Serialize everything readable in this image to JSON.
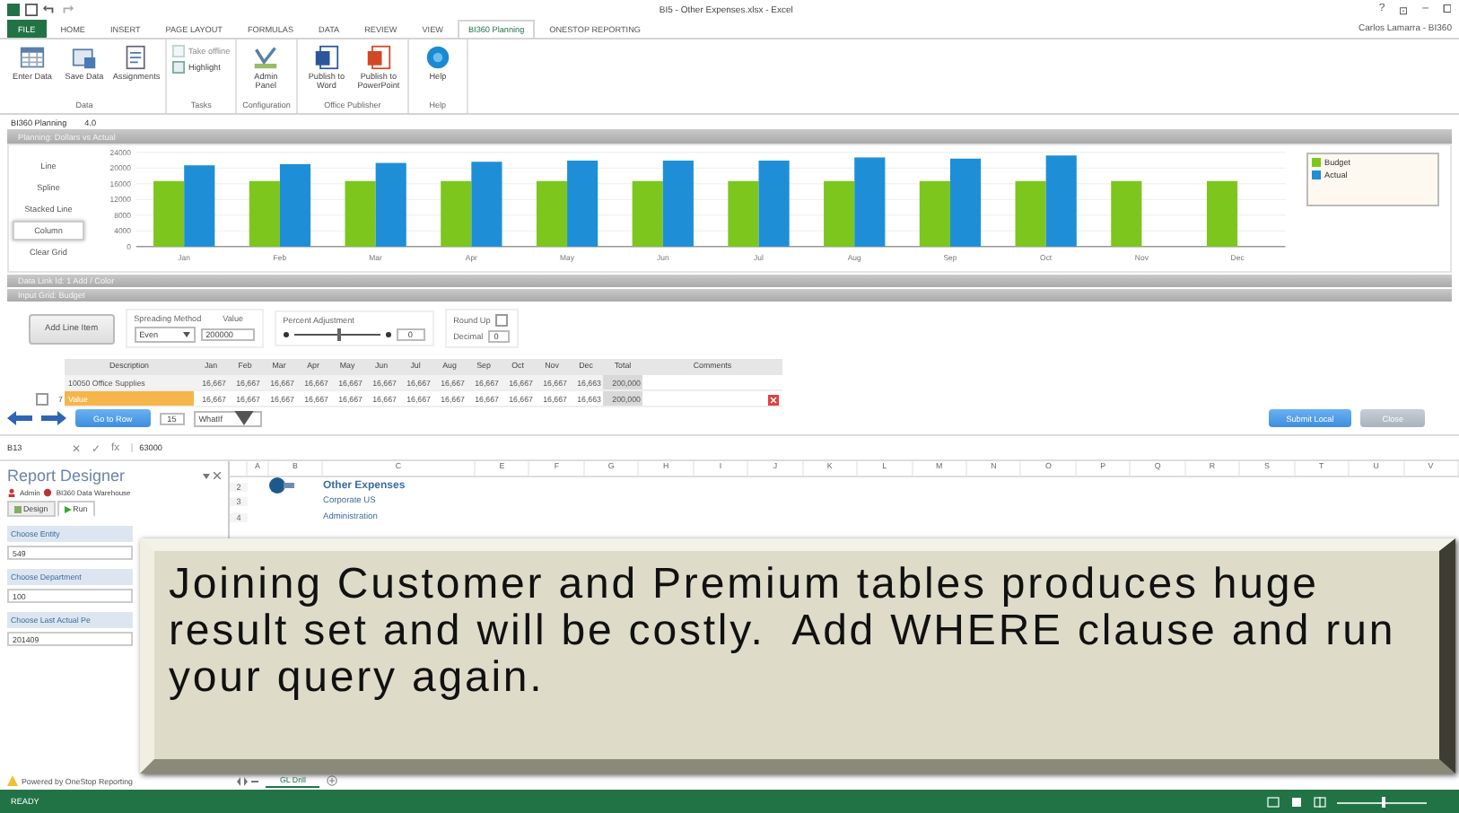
{
  "window": {
    "title": "BI5 - Other Expenses.xlsx - Excel",
    "controls": [
      "?",
      "⊡",
      "–",
      "⧠"
    ],
    "user": "Carlos Lamarra - BI360"
  },
  "ribbon_tabs": [
    {
      "label": "FILE",
      "kind": "file",
      "selected": false
    },
    {
      "label": "HOME",
      "kind": "tab",
      "selected": false
    },
    {
      "label": "INSERT",
      "kind": "tab",
      "selected": false
    },
    {
      "label": "PAGE LAYOUT",
      "kind": "tab",
      "selected": false
    },
    {
      "label": "FORMULAS",
      "kind": "tab",
      "selected": false
    },
    {
      "label": "DATA",
      "kind": "tab",
      "selected": false
    },
    {
      "label": "REVIEW",
      "kind": "tab",
      "selected": false
    },
    {
      "label": "VIEW",
      "kind": "tab",
      "selected": false
    },
    {
      "label": "BI360 Planning",
      "kind": "tab",
      "selected": true
    },
    {
      "label": "ONESTOP REPORTING",
      "kind": "tab",
      "selected": false
    }
  ],
  "ribbon_groups": [
    {
      "label": "Data",
      "buttons": [
        {
          "label": "Enter Data",
          "kind": "grid",
          "disabled": false
        },
        {
          "label": "Save Data",
          "kind": "save",
          "disabled": false
        },
        {
          "label": "Assignments",
          "kind": "list",
          "disabled": false
        }
      ]
    },
    {
      "label": "Tasks",
      "buttons": [
        {
          "label": "Take offline",
          "kind": "small",
          "disabled": true
        },
        {
          "label": "Highlight",
          "kind": "small",
          "disabled": false
        }
      ]
    },
    {
      "label": "Configuration",
      "buttons": [
        {
          "label": "Admin Panel",
          "kind": "admin",
          "disabled": false
        }
      ]
    },
    {
      "label": "Office Publisher",
      "buttons": [
        {
          "label": "Publish to Word",
          "kind": "word",
          "disabled": false
        },
        {
          "label": "Publish to PowerPoint",
          "kind": "slides",
          "disabled": false
        }
      ]
    },
    {
      "label": "Help",
      "buttons": [
        {
          "label": "Help",
          "kind": "help",
          "disabled": false
        }
      ]
    }
  ],
  "planning_bar": {
    "name": "BI360 Planning",
    "version": "4.0"
  },
  "chart_panel": {
    "title": "Planning: Dollars vs Actual",
    "chart_types": [
      {
        "label": "Line",
        "selected": false
      },
      {
        "label": "Spline",
        "selected": false
      },
      {
        "label": "Stacked Line",
        "selected": false
      },
      {
        "label": "Column",
        "selected": true
      },
      {
        "label": "Clear Grid",
        "selected": false
      }
    ],
    "chart_data": {
      "type": "bar",
      "categories": [
        "Jan",
        "Feb",
        "Mar",
        "Apr",
        "May",
        "Jun",
        "Jul",
        "Aug",
        "Sep",
        "Oct",
        "Nov",
        "Dec"
      ],
      "series": [
        {
          "name": "Budget",
          "color": "#7dc61e",
          "values": [
            16700,
            16700,
            16700,
            16700,
            16700,
            16700,
            16700,
            16700,
            16700,
            16700,
            16700,
            16700
          ]
        },
        {
          "name": "Actual",
          "color": "#1e8fd6",
          "values": [
            20700,
            21000,
            21300,
            21600,
            21900,
            21900,
            21900,
            22700,
            22400,
            23200,
            null,
            null
          ]
        }
      ],
      "grid": true,
      "ylim": [
        0,
        24000
      ],
      "yticks": [
        0,
        4000,
        8000,
        12000,
        16000,
        20000,
        24000
      ]
    }
  },
  "collapsed_panels": [
    {
      "title": "Data Link Id: 1  Add / Color"
    },
    {
      "title": "Input Grid: Budget"
    }
  ],
  "spreading": {
    "add_button": "Add Line Item",
    "method_label": "Spreading Method",
    "method": "Even",
    "value_label": "Value",
    "value": "200000",
    "percent_label": "Percent Adjustment",
    "level": 0.5,
    "percent": "0",
    "round_up_label": "Round Up",
    "round_up": false,
    "decimal_label": "Decimal",
    "decimal": "0"
  },
  "grid": {
    "columns": [
      "Description",
      "Jan",
      "Feb",
      "Mar",
      "Apr",
      "May",
      "Jun",
      "Jul",
      "Aug",
      "Sep",
      "Oct",
      "Nov",
      "Dec",
      "Total",
      "Comments"
    ],
    "rows": [
      {
        "kind": "parent",
        "description": "10050 Office Supplies",
        "values": [
          "16,667",
          "16,667",
          "16,667",
          "16,667",
          "16,667",
          "16,667",
          "16,667",
          "16,667",
          "16,667",
          "16,667",
          "16,667",
          "16,663"
        ],
        "total": "200,000"
      },
      {
        "kind": "line",
        "checked": false,
        "number": "7",
        "description": "Value",
        "values": [
          "16,667",
          "16,667",
          "16,667",
          "16,667",
          "16,667",
          "16,667",
          "16,667",
          "16,667",
          "16,667",
          "16,667",
          "16,667",
          "16,663"
        ],
        "total": "200,000"
      }
    ]
  },
  "grid_nav": {
    "go_button": "Go to Row",
    "row": "15",
    "mode": "WhatIf"
  },
  "actions": [
    "Submit Local",
    "Close"
  ],
  "formula_bar": {
    "cell": "B13",
    "symbols": [
      "✕",
      "✓",
      "fx"
    ],
    "value": "63000"
  },
  "report_designer": {
    "title": "Report Designer",
    "user": "Admin",
    "source": "BI360 Data Warehouse",
    "tabs": [
      {
        "label": "Design",
        "selected": false
      },
      {
        "label": "Run",
        "selected": true
      }
    ],
    "parameters": [
      {
        "label": "Choose Entity",
        "value": "549"
      },
      {
        "label": "Choose Department",
        "value": "100"
      },
      {
        "label": "Choose Last Actual Pe",
        "value": "201409"
      }
    ],
    "footer": "Powered by OneStop Reporting"
  },
  "sheet": {
    "columns": [
      "A",
      "B",
      "C",
      "E",
      "F",
      "G",
      "H",
      "I",
      "J",
      "K",
      "L",
      "M",
      "N",
      "O",
      "P",
      "Q",
      "R",
      "S",
      "T",
      "U",
      "V"
    ],
    "rows": [
      "2",
      "3",
      "4"
    ],
    "title": "Other Expenses",
    "lines": [
      "Corporate US",
      "Administration"
    ]
  },
  "sheet_tabs": [
    {
      "label": "GL Drill",
      "selected": true
    }
  ],
  "status_bar": {
    "mode": "READY",
    "zoom": {
      "level": 0.5
    }
  },
  "callout": {
    "text": "Joining Customer and Premium tables produces huge result set and will be costly.  Add WHERE clause and run your query again."
  }
}
